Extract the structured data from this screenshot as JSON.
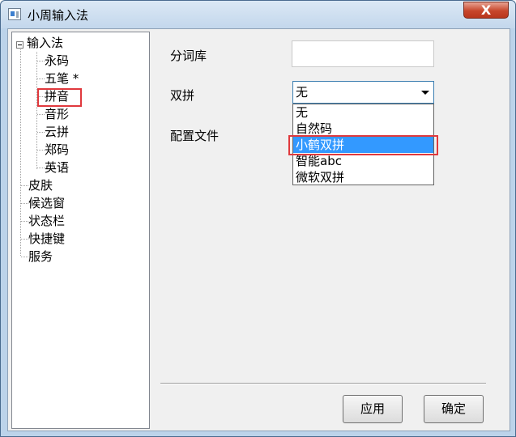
{
  "window": {
    "title": "小周输入法"
  },
  "titlebar": {
    "close_glyph": "X"
  },
  "tree": {
    "root_label": "输入法",
    "children": [
      "永码",
      "五笔 *",
      "拼音",
      "音形",
      "云拼",
      "郑码",
      "英语"
    ],
    "top_items": [
      "皮肤",
      "候选窗",
      "状态栏",
      "快捷键",
      "服务"
    ]
  },
  "form": {
    "dict_label": "分词库",
    "dict_value": "",
    "shuangpin_label": "双拼",
    "shuangpin_value": "无",
    "config_label": "配置文件"
  },
  "dropdown": {
    "options": [
      "无",
      "自然码",
      "小鹤双拼",
      "智能abc",
      "微软双拼"
    ],
    "selected_index": 2
  },
  "buttons": {
    "apply": "应用",
    "ok": "确定"
  },
  "colors": {
    "highlight_box": "#e0393d",
    "selection": "#3399ff"
  }
}
